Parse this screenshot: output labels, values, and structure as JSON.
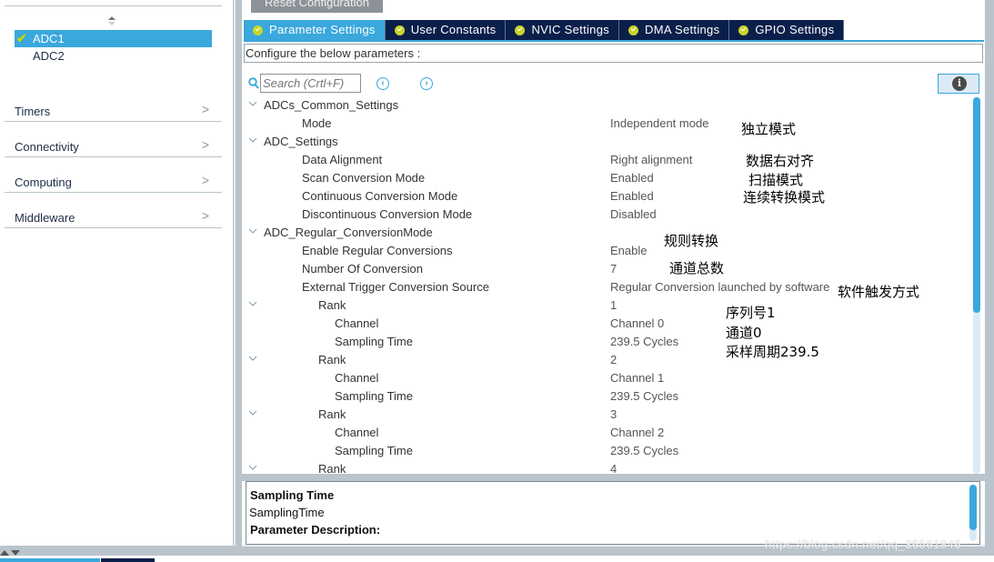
{
  "sidebar": {
    "instances": [
      {
        "label": "ADC1",
        "selected": true,
        "checked": true
      },
      {
        "label": "ADC2",
        "selected": false,
        "checked": false
      }
    ],
    "categories": [
      {
        "label": "Timers"
      },
      {
        "label": "Connectivity"
      },
      {
        "label": "Computing"
      },
      {
        "label": "Middleware"
      }
    ]
  },
  "toolbar": {
    "reset_label": "Reset Configuration"
  },
  "tabs": [
    {
      "label": "Parameter Settings",
      "active": true
    },
    {
      "label": "User Constants",
      "active": false
    },
    {
      "label": "NVIC Settings",
      "active": false
    },
    {
      "label": "DMA Settings",
      "active": false
    },
    {
      "label": "GPIO Settings",
      "active": false
    }
  ],
  "configure_text": "Configure the below parameters :",
  "search": {
    "placeholder": "Search (Crtl+F)",
    "value": ""
  },
  "icons": {
    "search": "search-icon",
    "prev": "chevron-left-circle-icon",
    "next": "chevron-right-circle-icon",
    "info": "info-icon",
    "expand": "chevron-down-icon",
    "check": "check-icon"
  },
  "tree": [
    {
      "name": "ADCs_Common_Settings",
      "value": "",
      "level": 0,
      "expandable": true
    },
    {
      "name": "Mode",
      "value": "Independent mode",
      "level": 2,
      "expandable": false
    },
    {
      "name": "ADC_Settings",
      "value": "",
      "level": 0,
      "expandable": true
    },
    {
      "name": "Data Alignment",
      "value": "Right alignment",
      "level": 2,
      "expandable": false
    },
    {
      "name": "Scan Conversion Mode",
      "value": "Enabled",
      "level": 2,
      "expandable": false
    },
    {
      "name": "Continuous Conversion Mode",
      "value": "Enabled",
      "level": 2,
      "expandable": false
    },
    {
      "name": "Discontinuous Conversion Mode",
      "value": "Disabled",
      "level": 2,
      "expandable": false
    },
    {
      "name": "ADC_Regular_ConversionMode",
      "value": "",
      "level": 0,
      "expandable": true
    },
    {
      "name": "Enable Regular Conversions",
      "value": "Enable",
      "level": 2,
      "expandable": false
    },
    {
      "name": "Number Of Conversion",
      "value": "7",
      "level": 2,
      "expandable": false
    },
    {
      "name": "External Trigger Conversion Source",
      "value": "Regular Conversion launched by software",
      "level": 2,
      "expandable": false
    },
    {
      "name": "Rank",
      "value": "1",
      "level": 3,
      "expandable": true
    },
    {
      "name": "Channel",
      "value": "Channel 0",
      "level": 4,
      "expandable": false
    },
    {
      "name": "Sampling Time",
      "value": "239.5 Cycles",
      "level": 4,
      "expandable": false
    },
    {
      "name": "Rank",
      "value": "2",
      "level": 3,
      "expandable": true
    },
    {
      "name": "Channel",
      "value": "Channel 1",
      "level": 4,
      "expandable": false
    },
    {
      "name": "Sampling Time",
      "value": "239.5 Cycles",
      "level": 4,
      "expandable": false
    },
    {
      "name": "Rank",
      "value": "3",
      "level": 3,
      "expandable": true
    },
    {
      "name": "Channel",
      "value": "Channel 2",
      "level": 4,
      "expandable": false
    },
    {
      "name": "Sampling Time",
      "value": "239.5 Cycles",
      "level": 4,
      "expandable": false
    },
    {
      "name": "Rank",
      "value": "4",
      "level": 3,
      "expandable": true
    }
  ],
  "annotations": [
    {
      "text": "独立模式"
    },
    {
      "text": "数据右对齐"
    },
    {
      "text": "扫描模式"
    },
    {
      "text": "连续转换模式"
    },
    {
      "text": "规则转换"
    },
    {
      "text": "通道总数"
    },
    {
      "text": "软件触发方式"
    },
    {
      "text": "序列号1"
    },
    {
      "text": "通道0"
    },
    {
      "text": "采样周期239.5"
    }
  ],
  "description": {
    "title": "Sampling Time",
    "name": "SamplingTime",
    "label": "Parameter Description:"
  },
  "watermark": "https://blog.csdn.net/qq_36561846",
  "colors": {
    "accent": "#3aa8dc",
    "tab_dark": "#0b1f4b",
    "check": "#c9d52a",
    "frame": "#bac4cc"
  }
}
